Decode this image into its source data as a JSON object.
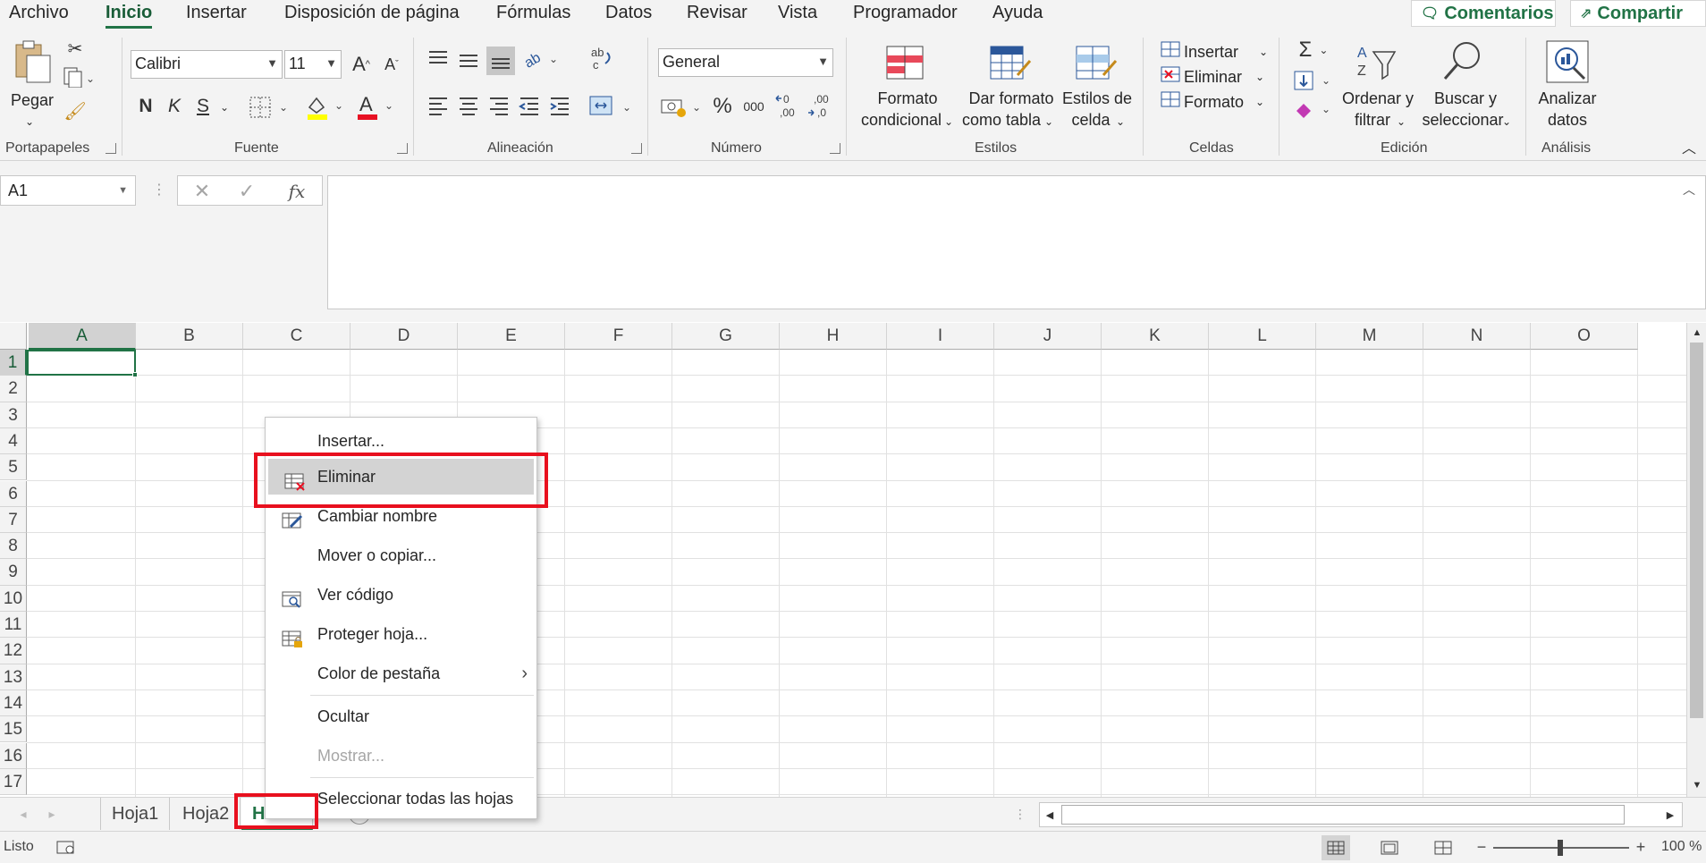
{
  "ribbon_tabs": [
    "Archivo",
    "Inicio",
    "Insertar",
    "Disposición de página",
    "Fórmulas",
    "Datos",
    "Revisar",
    "Vista",
    "Programador",
    "Ayuda"
  ],
  "top_buttons": {
    "comments": "Comentarios",
    "share": "Compartir"
  },
  "clipboard": {
    "paste": "Pegar",
    "group": "Portapapeles"
  },
  "font": {
    "name": "Calibri",
    "size": "11",
    "bold": "N",
    "italic": "K",
    "underline": "S",
    "group": "Fuente",
    "grow": "A",
    "shrink": "A"
  },
  "alignment": {
    "group": "Alineación"
  },
  "number": {
    "format": "General",
    "group": "Número",
    "percent": "%",
    "thousands": "000"
  },
  "styles": {
    "conditional_l1": "Formato",
    "conditional_l2": "condicional",
    "table_l1": "Dar formato",
    "table_l2": "como tabla",
    "cell_l1": "Estilos de",
    "cell_l2": "celda",
    "group": "Estilos"
  },
  "cells": {
    "insert": "Insertar",
    "delete": "Eliminar",
    "format": "Formato",
    "group": "Celdas"
  },
  "editing": {
    "sort_l1": "Ordenar y",
    "sort_l2": "filtrar",
    "find_l1": "Buscar y",
    "find_l2": "seleccionar",
    "group": "Edición"
  },
  "analysis": {
    "analyze_l1": "Analizar",
    "analyze_l2": "datos",
    "group": "Análisis"
  },
  "formula_bar": {
    "name_box": "A1",
    "fx": "fx",
    "formula": ""
  },
  "grid": {
    "columns": [
      "A",
      "B",
      "C",
      "D",
      "E",
      "F",
      "G",
      "H",
      "I",
      "J",
      "K",
      "L",
      "M",
      "N",
      "O"
    ],
    "rows": [
      "1",
      "2",
      "3",
      "4",
      "5",
      "6",
      "7",
      "8",
      "9",
      "10",
      "11",
      "12",
      "13",
      "14",
      "15",
      "16",
      "17"
    ],
    "selected_cell": "A1"
  },
  "context_menu": {
    "items": [
      {
        "label": "Insertar...",
        "icon": "none"
      },
      {
        "label": "Eliminar",
        "icon": "delete-sheet-icon"
      },
      {
        "label": "Cambiar nombre",
        "icon": "rename-sheet-icon"
      },
      {
        "label": "Mover o copiar...",
        "icon": "none"
      },
      {
        "label": "Ver código",
        "icon": "view-code-icon"
      },
      {
        "label": "Proteger hoja...",
        "icon": "protect-sheet-icon"
      },
      {
        "label": "Color de pestaña",
        "icon": "none"
      },
      {
        "label": "Ocultar",
        "icon": "none"
      },
      {
        "label": "Mostrar...",
        "icon": "none",
        "disabled": true
      },
      {
        "label": "Seleccionar todas las hojas",
        "icon": "none"
      }
    ],
    "highlighted": "Eliminar"
  },
  "sheets": {
    "tabs": [
      "Hoja1",
      "Hoja2",
      "H"
    ],
    "active": "H"
  },
  "status": {
    "ready": "Listo",
    "zoom": "100 %"
  },
  "colors": {
    "accent": "#217346",
    "highlight_box": "#e8101e"
  }
}
